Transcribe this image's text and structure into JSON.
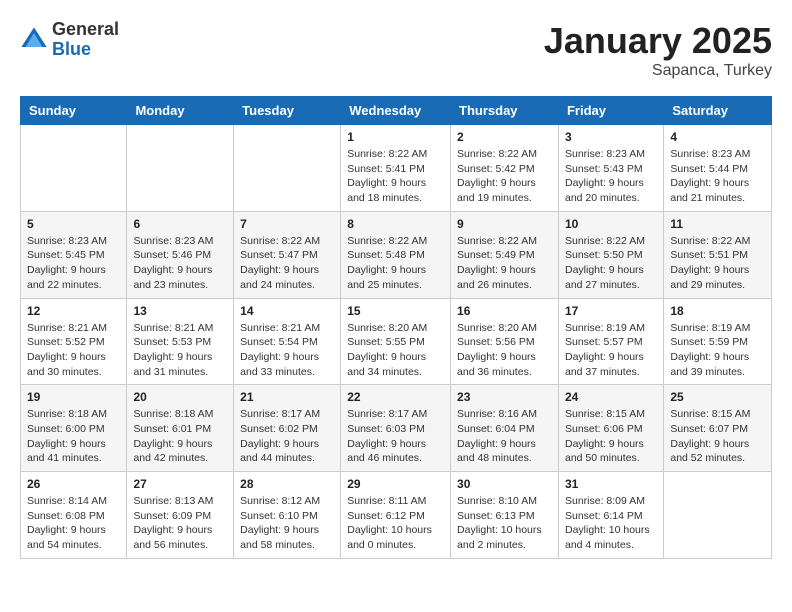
{
  "header": {
    "logo_general": "General",
    "logo_blue": "Blue",
    "title": "January 2025",
    "location": "Sapanca, Turkey"
  },
  "weekdays": [
    "Sunday",
    "Monday",
    "Tuesday",
    "Wednesday",
    "Thursday",
    "Friday",
    "Saturday"
  ],
  "weeks": [
    [
      {
        "day": "",
        "info": ""
      },
      {
        "day": "",
        "info": ""
      },
      {
        "day": "",
        "info": ""
      },
      {
        "day": "1",
        "info": "Sunrise: 8:22 AM\nSunset: 5:41 PM\nDaylight: 9 hours\nand 18 minutes."
      },
      {
        "day": "2",
        "info": "Sunrise: 8:22 AM\nSunset: 5:42 PM\nDaylight: 9 hours\nand 19 minutes."
      },
      {
        "day": "3",
        "info": "Sunrise: 8:23 AM\nSunset: 5:43 PM\nDaylight: 9 hours\nand 20 minutes."
      },
      {
        "day": "4",
        "info": "Sunrise: 8:23 AM\nSunset: 5:44 PM\nDaylight: 9 hours\nand 21 minutes."
      }
    ],
    [
      {
        "day": "5",
        "info": "Sunrise: 8:23 AM\nSunset: 5:45 PM\nDaylight: 9 hours\nand 22 minutes."
      },
      {
        "day": "6",
        "info": "Sunrise: 8:23 AM\nSunset: 5:46 PM\nDaylight: 9 hours\nand 23 minutes."
      },
      {
        "day": "7",
        "info": "Sunrise: 8:22 AM\nSunset: 5:47 PM\nDaylight: 9 hours\nand 24 minutes."
      },
      {
        "day": "8",
        "info": "Sunrise: 8:22 AM\nSunset: 5:48 PM\nDaylight: 9 hours\nand 25 minutes."
      },
      {
        "day": "9",
        "info": "Sunrise: 8:22 AM\nSunset: 5:49 PM\nDaylight: 9 hours\nand 26 minutes."
      },
      {
        "day": "10",
        "info": "Sunrise: 8:22 AM\nSunset: 5:50 PM\nDaylight: 9 hours\nand 27 minutes."
      },
      {
        "day": "11",
        "info": "Sunrise: 8:22 AM\nSunset: 5:51 PM\nDaylight: 9 hours\nand 29 minutes."
      }
    ],
    [
      {
        "day": "12",
        "info": "Sunrise: 8:21 AM\nSunset: 5:52 PM\nDaylight: 9 hours\nand 30 minutes."
      },
      {
        "day": "13",
        "info": "Sunrise: 8:21 AM\nSunset: 5:53 PM\nDaylight: 9 hours\nand 31 minutes."
      },
      {
        "day": "14",
        "info": "Sunrise: 8:21 AM\nSunset: 5:54 PM\nDaylight: 9 hours\nand 33 minutes."
      },
      {
        "day": "15",
        "info": "Sunrise: 8:20 AM\nSunset: 5:55 PM\nDaylight: 9 hours\nand 34 minutes."
      },
      {
        "day": "16",
        "info": "Sunrise: 8:20 AM\nSunset: 5:56 PM\nDaylight: 9 hours\nand 36 minutes."
      },
      {
        "day": "17",
        "info": "Sunrise: 8:19 AM\nSunset: 5:57 PM\nDaylight: 9 hours\nand 37 minutes."
      },
      {
        "day": "18",
        "info": "Sunrise: 8:19 AM\nSunset: 5:59 PM\nDaylight: 9 hours\nand 39 minutes."
      }
    ],
    [
      {
        "day": "19",
        "info": "Sunrise: 8:18 AM\nSunset: 6:00 PM\nDaylight: 9 hours\nand 41 minutes."
      },
      {
        "day": "20",
        "info": "Sunrise: 8:18 AM\nSunset: 6:01 PM\nDaylight: 9 hours\nand 42 minutes."
      },
      {
        "day": "21",
        "info": "Sunrise: 8:17 AM\nSunset: 6:02 PM\nDaylight: 9 hours\nand 44 minutes."
      },
      {
        "day": "22",
        "info": "Sunrise: 8:17 AM\nSunset: 6:03 PM\nDaylight: 9 hours\nand 46 minutes."
      },
      {
        "day": "23",
        "info": "Sunrise: 8:16 AM\nSunset: 6:04 PM\nDaylight: 9 hours\nand 48 minutes."
      },
      {
        "day": "24",
        "info": "Sunrise: 8:15 AM\nSunset: 6:06 PM\nDaylight: 9 hours\nand 50 minutes."
      },
      {
        "day": "25",
        "info": "Sunrise: 8:15 AM\nSunset: 6:07 PM\nDaylight: 9 hours\nand 52 minutes."
      }
    ],
    [
      {
        "day": "26",
        "info": "Sunrise: 8:14 AM\nSunset: 6:08 PM\nDaylight: 9 hours\nand 54 minutes."
      },
      {
        "day": "27",
        "info": "Sunrise: 8:13 AM\nSunset: 6:09 PM\nDaylight: 9 hours\nand 56 minutes."
      },
      {
        "day": "28",
        "info": "Sunrise: 8:12 AM\nSunset: 6:10 PM\nDaylight: 9 hours\nand 58 minutes."
      },
      {
        "day": "29",
        "info": "Sunrise: 8:11 AM\nSunset: 6:12 PM\nDaylight: 10 hours\nand 0 minutes."
      },
      {
        "day": "30",
        "info": "Sunrise: 8:10 AM\nSunset: 6:13 PM\nDaylight: 10 hours\nand 2 minutes."
      },
      {
        "day": "31",
        "info": "Sunrise: 8:09 AM\nSunset: 6:14 PM\nDaylight: 10 hours\nand 4 minutes."
      },
      {
        "day": "",
        "info": ""
      }
    ]
  ]
}
